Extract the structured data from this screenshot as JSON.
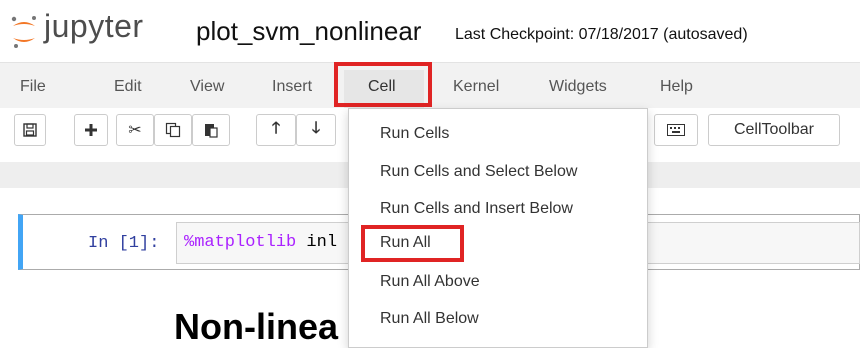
{
  "header": {
    "logo_text": "jupyter",
    "notebook_title": "plot_svm_nonlinear",
    "checkpoint": "Last Checkpoint: 07/18/2017 (autosaved)"
  },
  "menubar": {
    "items": [
      "File",
      "Edit",
      "View",
      "Insert",
      "Cell",
      "Kernel",
      "Widgets",
      "Help"
    ]
  },
  "toolbar": {
    "buttons": [
      "save-icon",
      "plus-icon",
      "scissors-icon",
      "copy-icon",
      "paste-icon",
      "arrow-up-icon",
      "arrow-down-icon",
      "keyboard-icon"
    ],
    "celltoolbar_label": "CellToolbar"
  },
  "cell_menu": {
    "items": [
      "Run Cells",
      "Run Cells and Select Below",
      "Run Cells and Insert Below",
      "Run All",
      "Run All Above",
      "Run All Below"
    ]
  },
  "cell": {
    "prompt": "In [1]:",
    "code_magic": "%matplotlib",
    "code_rest": " inl"
  },
  "markdown": {
    "heading": "Non-linea"
  },
  "colors": {
    "highlight": "#e02424",
    "cell_border": "#42a5f5",
    "prompt": "#303f9f"
  }
}
